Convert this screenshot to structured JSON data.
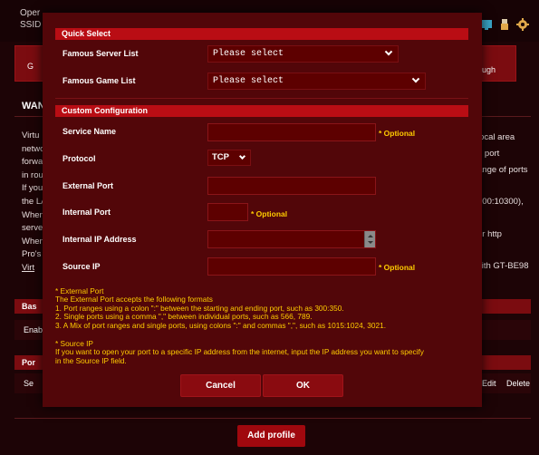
{
  "background": {
    "top_lines": [
      "Oper",
      "SSID"
    ],
    "tab_left": "G",
    "tab_right": [
      "r",
      "ough"
    ],
    "page_title": "WAN",
    "left_col_lines": [
      "Virtu",
      "netwo",
      "forwa",
      "in rou",
      "If you",
      "the LA",
      "When",
      "serve",
      "When",
      "Pro's",
      "Virt"
    ],
    "right_col_lines": [
      "local area",
      "e port",
      "ange of ports",
      "",
      "200:10300),",
      "",
      "ur http",
      "",
      "vith GT-BE98"
    ],
    "basic_bar": "Bas",
    "enable_row": "Enab",
    "port_bar": "Por",
    "list_row_label": "Se",
    "col_edit": "Edit",
    "col_delete": "Delete",
    "add_profile": "Add profile",
    "icons": [
      "network-icon",
      "usb-icon",
      "gear-icon"
    ]
  },
  "modal": {
    "quick_select": {
      "heading": "Quick Select",
      "famous_server_label": "Famous Server List",
      "famous_server_value": "Please select",
      "famous_game_label": "Famous Game List",
      "famous_game_value": "Please select"
    },
    "custom": {
      "heading": "Custom Configuration",
      "service_name_label": "Service Name",
      "service_name_value": "",
      "protocol_label": "Protocol",
      "protocol_value": "TCP",
      "external_port_label": "External Port",
      "external_port_value": "",
      "internal_port_label": "Internal Port",
      "internal_port_value": "",
      "internal_ip_label": "Internal IP Address",
      "internal_ip_value": "",
      "source_ip_label": "Source IP",
      "source_ip_value": "",
      "optional_hint": "* Optional"
    },
    "notes": {
      "external_title": "* External Port",
      "external_lines": [
        "The External Port accepts the following formats",
        "1. Port ranges using a colon \":\" between the starting and ending port, such as 300:350.",
        "2. Single ports using a comma \",\" between individual ports, such as 566, 789.",
        "3. A Mix of port ranges and single ports, using colons \":\" and commas \",\", such as 1015:1024, 3021."
      ],
      "source_title": "* Source IP",
      "source_lines": [
        "If you want to open your port to a specific IP address from the internet, input the IP address you want to specify",
        "in the Source IP field."
      ]
    },
    "buttons": {
      "cancel": "Cancel",
      "ok": "OK"
    }
  },
  "colors": {
    "modal_bg": "#520609",
    "section_bar": "#b90d14",
    "accent_text": "#ffcc00",
    "button": "#8a0b10"
  }
}
